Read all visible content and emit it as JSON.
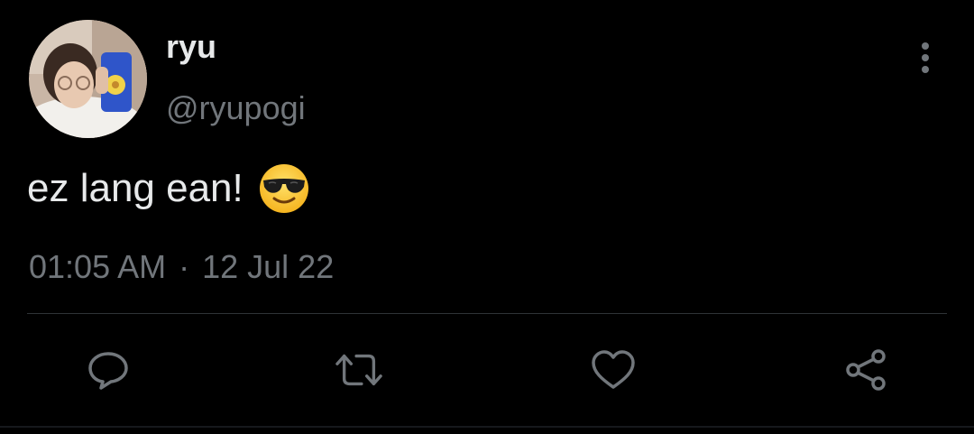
{
  "user": {
    "display_name": "ryu",
    "handle": "@ryupogi"
  },
  "tweet": {
    "text": "ez lang ean!",
    "emoji": "smiling-face-with-sunglasses",
    "time": "01:05 AM",
    "separator": "·",
    "date": "12 Jul 22"
  },
  "icons": {
    "more": "more-vertical-icon",
    "reply": "reply-icon",
    "retweet": "retweet-icon",
    "like": "heart-icon",
    "share": "share-icon"
  },
  "colors": {
    "background": "#000000",
    "text_primary": "#e7e9ea",
    "text_secondary": "#71767b",
    "divider": "#2f3336"
  }
}
